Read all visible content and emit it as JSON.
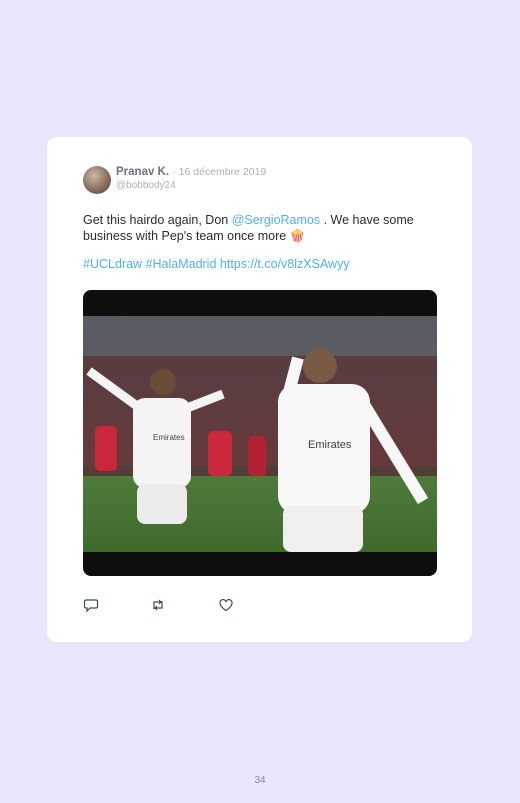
{
  "tweet": {
    "author_name": "Pranav K.",
    "date": "· 16 décembre 2019",
    "handle": "@bobbody24",
    "text_part1": "Get this hairdo again, Don ",
    "mention": "@SergioRamos",
    "text_part2": " . We have some business with Pep's team once more 🍿",
    "hashtag1": "#UCLdraw",
    "hashtag2": "#HalaMadrid",
    "link": "https://t.co/v8lzXSAwyy"
  },
  "actions": {
    "reply_icon": "reply-icon",
    "retweet_icon": "retweet-icon",
    "like_icon": "heart-icon"
  },
  "page": {
    "number": "34"
  },
  "colors": {
    "background": "#e9e6fb",
    "link": "#4fb2e8",
    "card": "#ffffff"
  }
}
